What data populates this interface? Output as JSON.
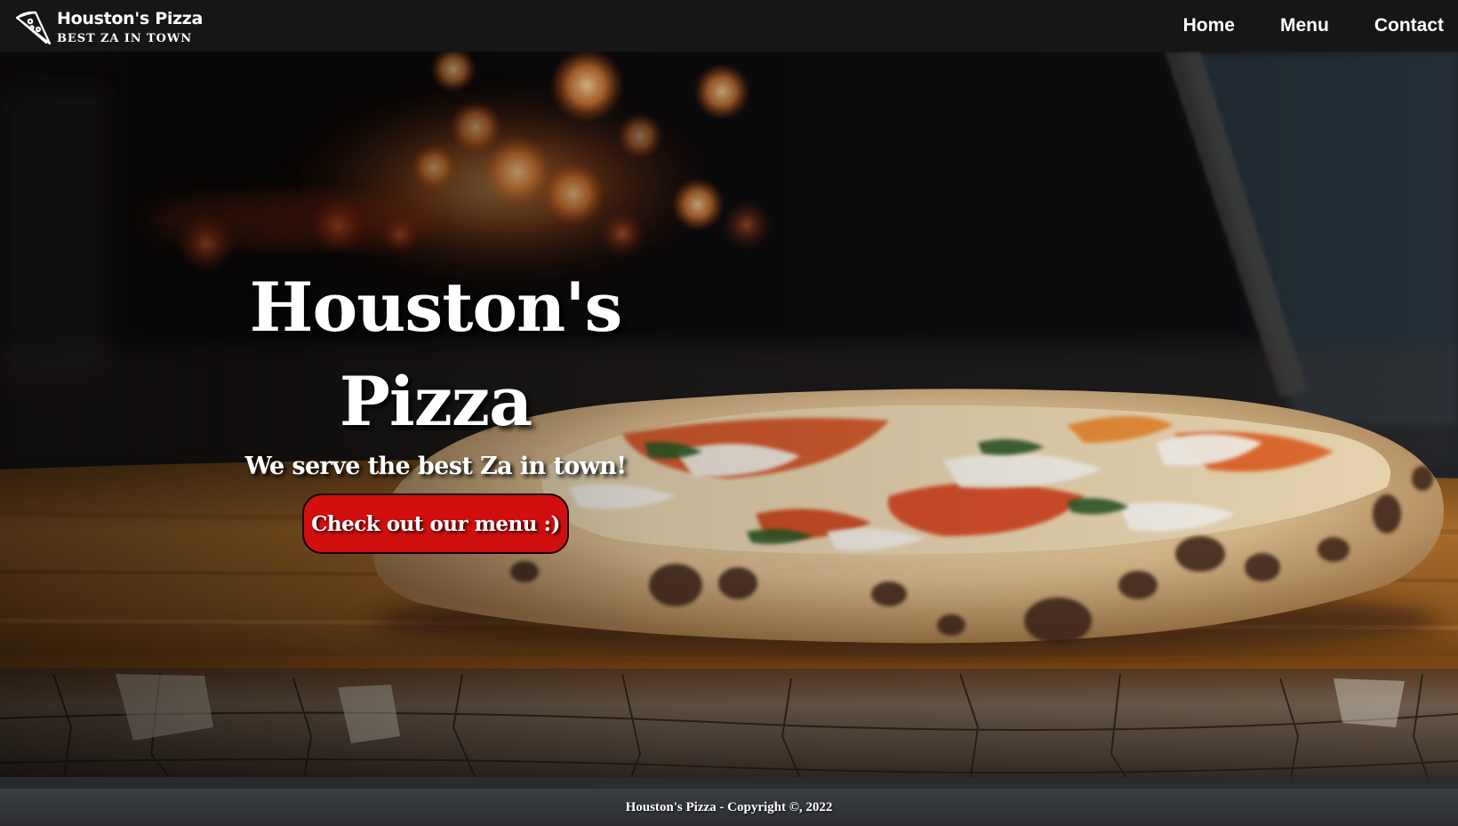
{
  "brand": {
    "name": "Houston's Pizza",
    "tagline": "BEST ZA IN TOWN",
    "logo_icon": "pizza-slice-icon"
  },
  "nav": {
    "items": [
      {
        "label": "Home"
      },
      {
        "label": "Menu"
      },
      {
        "label": "Contact"
      }
    ]
  },
  "hero": {
    "title_line1": "Houston's",
    "title_line2": "Pizza",
    "subtitle": "We serve the best Za in town!",
    "cta_label": "Check out our menu :)",
    "background": "pizza-on-wooden-board-photo"
  },
  "footer": {
    "text": "Houston's Pizza - Copyright ©, 2022"
  },
  "colors": {
    "navbar_bg": "#161616",
    "cta_bg": "#d10f0f",
    "footer_bg": "#33363a",
    "text": "#ffffff"
  }
}
